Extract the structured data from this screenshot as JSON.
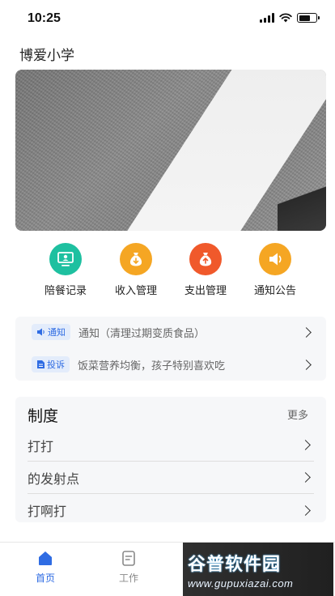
{
  "status_bar": {
    "time": "10:25",
    "battery_level": 0.65
  },
  "header": {
    "title": "博爱小学"
  },
  "quick_menu": [
    {
      "label": "陪餐记录",
      "icon": "monitor-icon",
      "color": "#1ec0a0"
    },
    {
      "label": "收入管理",
      "icon": "money-bag-in-icon",
      "color": "#f5a623"
    },
    {
      "label": "支出管理",
      "icon": "money-bag-out-icon",
      "color": "#f0592b"
    },
    {
      "label": "通知公告",
      "icon": "speaker-icon",
      "color": "#f5a623"
    }
  ],
  "notices": [
    {
      "tag": "通知",
      "tag_icon": "speaker-icon",
      "text": "通知（清理过期变质食品）"
    },
    {
      "tag": "投诉",
      "tag_icon": "document-icon",
      "text": "饭菜营养均衡，孩子特别喜欢吃"
    }
  ],
  "policy": {
    "title": "制度",
    "more_label": "更多",
    "items": [
      "打打",
      "的发射点",
      "打啊打"
    ]
  },
  "tab_bar": {
    "active_color": "#2f6ce3",
    "inactive_color": "#888888",
    "tabs": [
      {
        "label": "首页",
        "icon": "home-icon",
        "active": true
      },
      {
        "label": "工作",
        "icon": "clipboard-icon",
        "active": false
      }
    ]
  },
  "watermark": {
    "brand": "谷普软件园",
    "url": "www.gupuxiazai.com"
  }
}
